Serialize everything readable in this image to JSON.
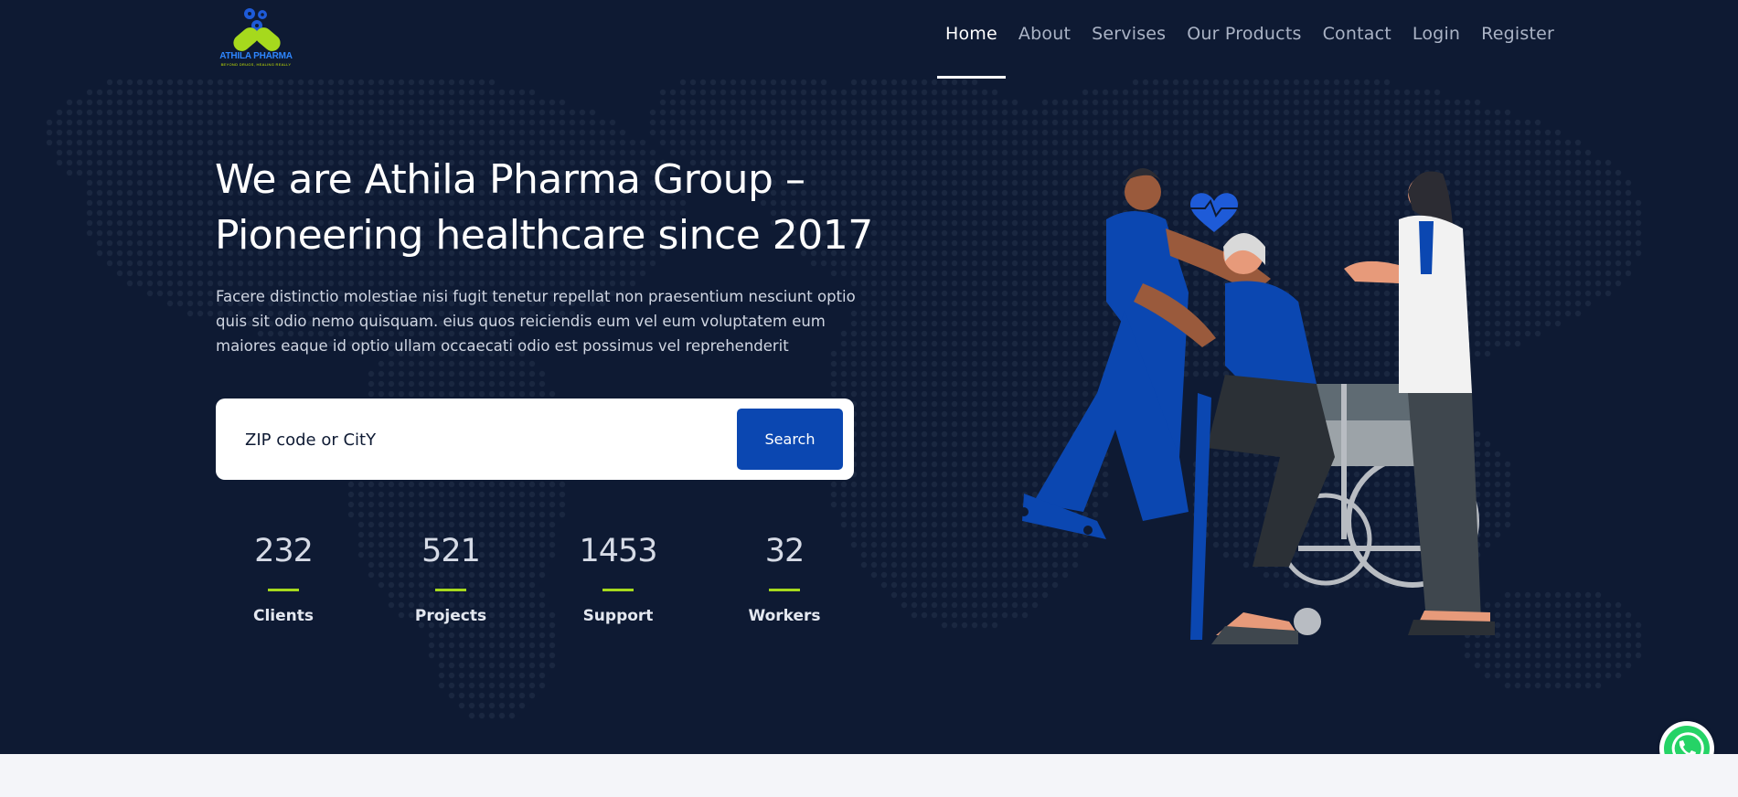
{
  "brand": {
    "logo_text": "ATHILA PHARMA",
    "logo_tagline": "BEYOND DRUGS, HEALING REALLY"
  },
  "nav": {
    "items": [
      "Home",
      "About",
      "Servises",
      "Our Products",
      "Contact",
      "Login",
      "Register"
    ],
    "active": "Home"
  },
  "hero": {
    "title_line1": "We are Athila Pharma Group –",
    "title_line2": "Pioneering healthcare since 2017",
    "description": "Facere distinctio molestiae nisi fugit tenetur repellat non praesentium nesciunt optio quis sit odio nemo quisquam. eius quos reiciendis eum vel eum voluptatem eum maiores eaque id optio ullam occaecati odio est possimus vel reprehenderit"
  },
  "search": {
    "placeholder": "ZIP code or CitY",
    "value": "",
    "button_label": "Search"
  },
  "stats": [
    {
      "value": "232",
      "label": "Clients"
    },
    {
      "value": "521",
      "label": "Projects"
    },
    {
      "value": "1453",
      "label": "Support"
    },
    {
      "value": "32",
      "label": "Workers"
    }
  ],
  "colors": {
    "hero_background": "#0e1a33",
    "accent_blue": "#0b47b1",
    "accent_green": "#a6d91d",
    "page_background": "#f4f5f9"
  },
  "icons": {
    "floating_action": "whatsapp-icon",
    "illustration": "caregivers-with-patient-in-wheelchair"
  }
}
